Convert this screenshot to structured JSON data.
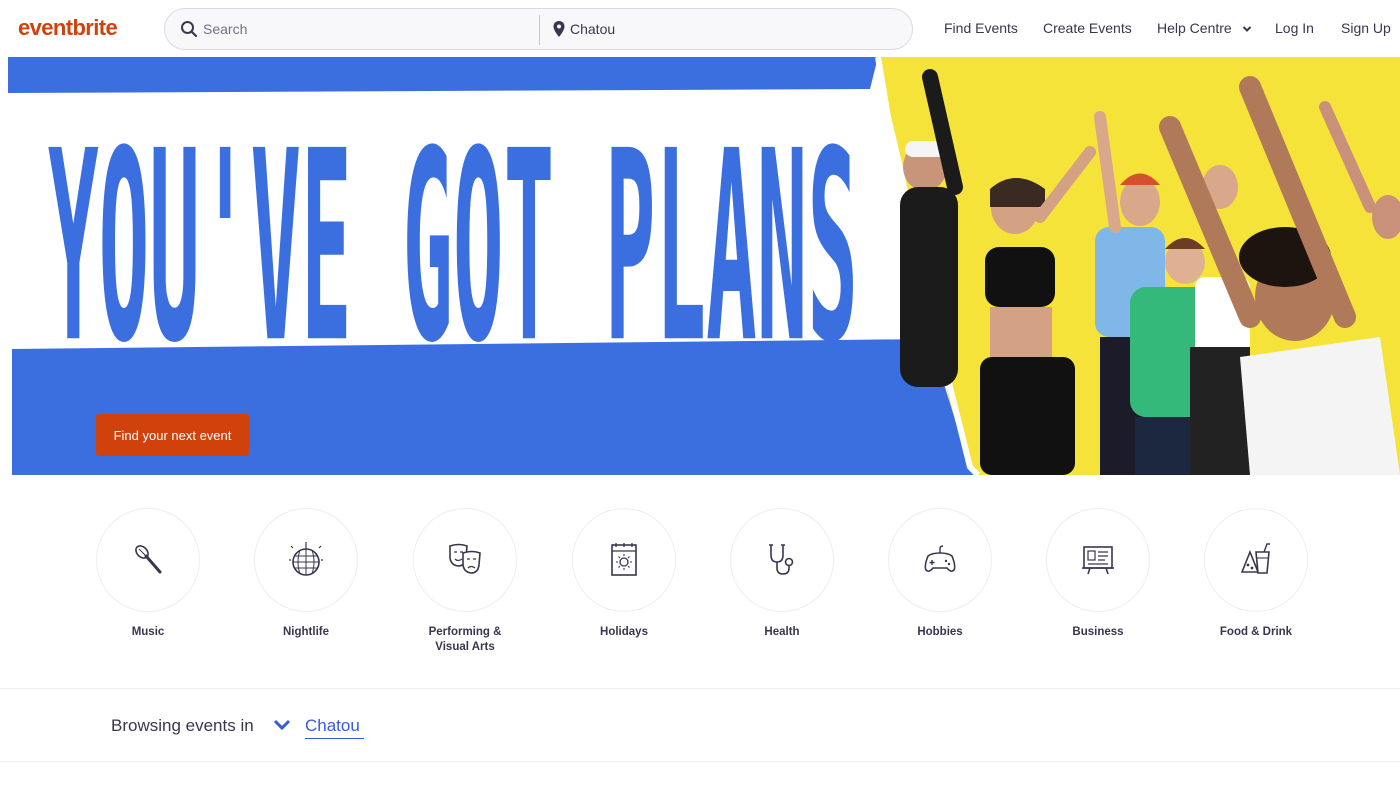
{
  "brand": {
    "logo_text": "eventbrite",
    "accent": "#d1410c",
    "link_color": "#3659e3",
    "hero_blue": "#3b6fe0",
    "hero_yellow": "#f6e33a"
  },
  "header": {
    "search_placeholder": "Search",
    "search_icon": "search-icon",
    "location_value": "Chatou",
    "location_icon": "map-pin-icon",
    "nav": {
      "find_events": "Find Events",
      "create_events": "Create Events",
      "help_centre": "Help Centre",
      "log_in": "Log In",
      "sign_up": "Sign Up"
    }
  },
  "hero": {
    "headline": "YOU'VE GOT PLANS",
    "cta_label": "Find your next event"
  },
  "categories": [
    {
      "label": "Music",
      "icon": "microphone-icon"
    },
    {
      "label": "Nightlife",
      "icon": "disco-ball-icon"
    },
    {
      "label": "Performing & Visual Arts",
      "icon": "theater-masks-icon"
    },
    {
      "label": "Holidays",
      "icon": "calendar-sun-icon"
    },
    {
      "label": "Health",
      "icon": "stethoscope-icon"
    },
    {
      "label": "Hobbies",
      "icon": "gamepad-icon"
    },
    {
      "label": "Business",
      "icon": "presentation-board-icon"
    },
    {
      "label": "Food & Drink",
      "icon": "food-drink-icon"
    }
  ],
  "browsing": {
    "label": "Browsing events in",
    "city": "Chatou"
  }
}
